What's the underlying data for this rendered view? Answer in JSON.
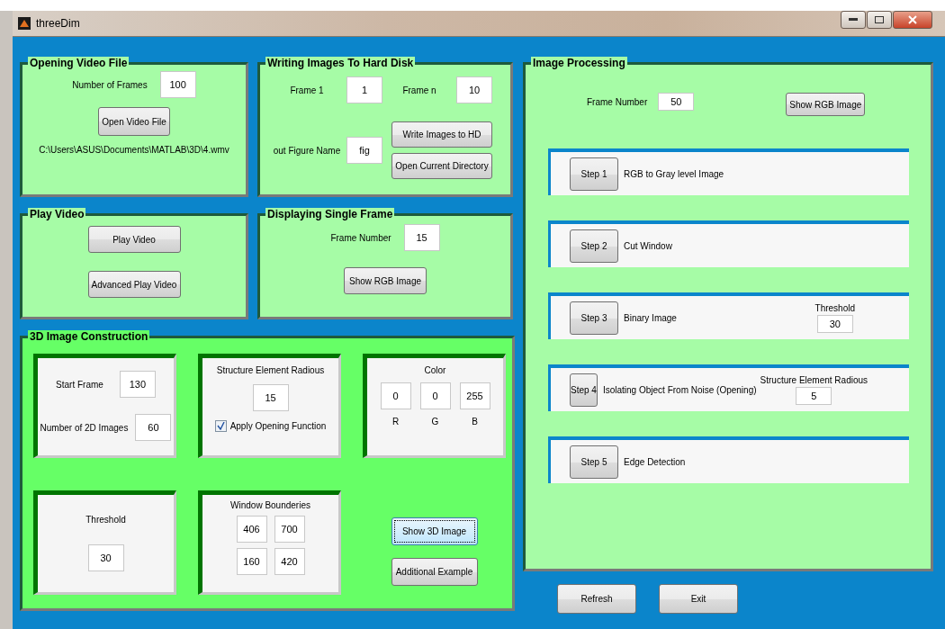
{
  "window": {
    "title": "threeDim"
  },
  "opening_video": {
    "title": "Opening Video File",
    "frames_label": "Number of Frames",
    "frames_value": "100",
    "button": "Open Video File",
    "path": "C:\\Users\\ASUS\\Documents\\MATLAB\\3D\\4.wmv"
  },
  "writing_images": {
    "title": "Writing Images To Hard Disk",
    "frame1_label": "Frame 1",
    "frame1_value": "1",
    "framen_label": "Frame n",
    "framen_value": "10",
    "name_label": "out Figure Name",
    "name_value": "fig",
    "buttons": [
      "Write Images to HD",
      "Open Current Directory"
    ]
  },
  "play_video": {
    "title": "Play Video",
    "buttons": [
      "Play Video",
      "Advanced Play Video"
    ]
  },
  "single_frame": {
    "title": "Displaying Single Frame",
    "label": "Frame Number",
    "value": "15",
    "button": "Show RGB Image"
  },
  "construction": {
    "title": "3D Image Construction",
    "start_label": "Start Frame",
    "start_value": "130",
    "count_label": "Number of 2D Images",
    "count_value": "60",
    "radius_label": "Structure Element Radious",
    "radius_value": "15",
    "checkbox": {
      "label": "Apply Opening Function",
      "checked": true
    },
    "color": {
      "label": "Color",
      "values": [
        "0",
        "0",
        "255"
      ],
      "channels": [
        "R",
        "G",
        "B"
      ]
    },
    "threshold": {
      "label": "Threshold",
      "value": "30"
    },
    "bounds": {
      "label": "Window Bounderies",
      "values": [
        "406",
        "700",
        "160",
        "420"
      ]
    },
    "buttons": [
      {
        "label": "Show 3D Image",
        "focused": true
      },
      {
        "label": "Additional Example",
        "focused": false
      }
    ]
  },
  "processing": {
    "title": "Image Processing",
    "frame_label": "Frame Number",
    "frame_value": "50",
    "button": "Show RGB Image",
    "steps": [
      {
        "button": "Step 1",
        "description": "RGB to Gray level Image"
      },
      {
        "button": "Step 2",
        "description": "Cut Window"
      },
      {
        "button": "Step 3",
        "description": "Binary Image",
        "param_label": "Threshold",
        "param_value": "30"
      },
      {
        "button": "Step 4",
        "description": "Isolating Object From Noise (Opening)",
        "param_label": "Structure Element Radious",
        "param_value": "5"
      },
      {
        "button": "Step 5",
        "description": "Edge Detection"
      }
    ]
  },
  "footer_buttons": [
    "Refresh",
    "Exit"
  ]
}
